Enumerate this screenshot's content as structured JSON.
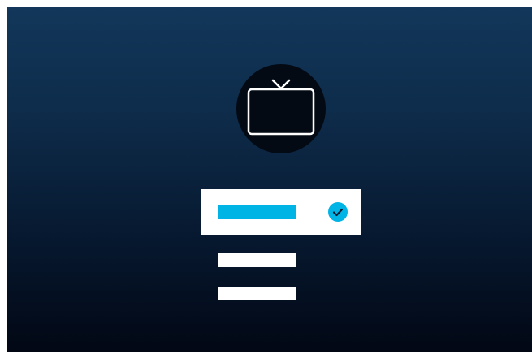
{
  "screen": {
    "background_top": "#12375a",
    "background_bottom": "#020714"
  },
  "icon": {
    "name": "tv-icon",
    "circle_color": "#040a14",
    "stroke_color": "#ffffff"
  },
  "options": [
    {
      "name": "option-1",
      "selected": true,
      "bar_color": "#00b4e6",
      "background": "#ffffff",
      "indicator": "check-circle-icon"
    },
    {
      "name": "option-2",
      "selected": false,
      "bar_color": "#ffffff"
    },
    {
      "name": "option-3",
      "selected": false,
      "bar_color": "#ffffff"
    }
  ],
  "accent_color": "#00b4e6"
}
